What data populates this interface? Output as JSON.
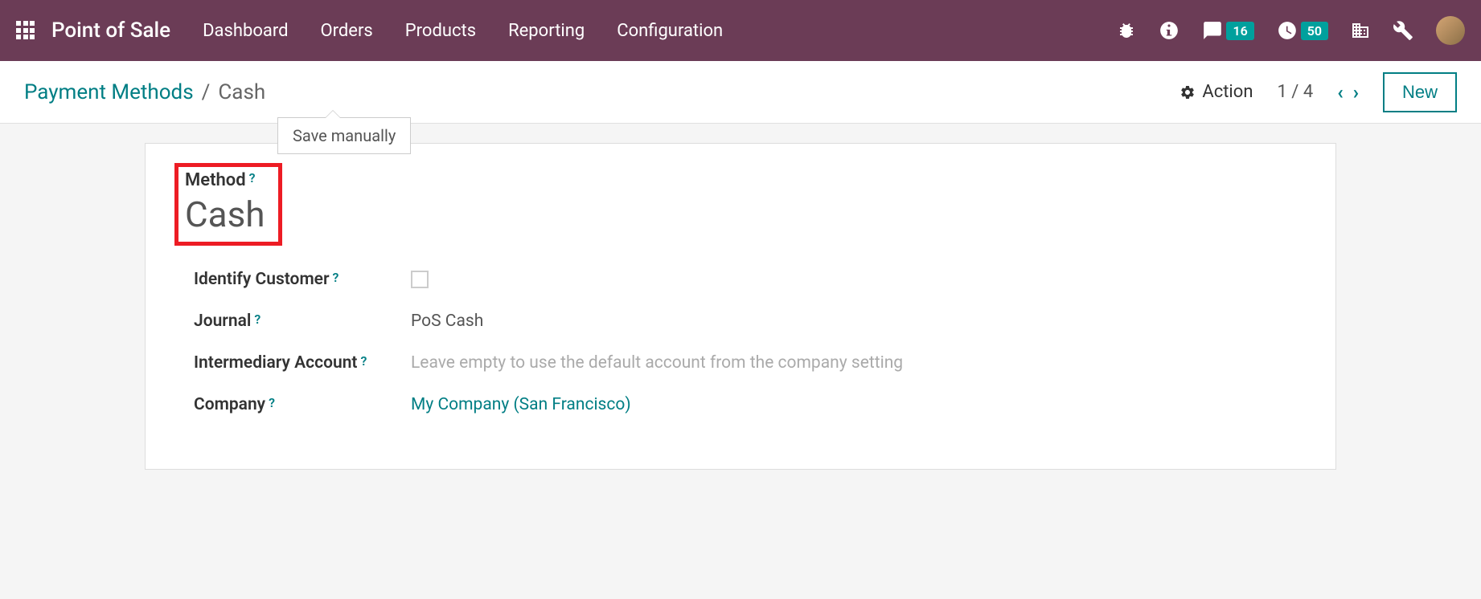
{
  "app": {
    "title": "Point of Sale"
  },
  "nav": {
    "dashboard": "Dashboard",
    "orders": "Orders",
    "products": "Products",
    "reporting": "Reporting",
    "configuration": "Configuration"
  },
  "badges": {
    "messages": "16",
    "activities": "50"
  },
  "breadcrumb": {
    "parent": "Payment Methods",
    "separator": "/",
    "current": "Cash"
  },
  "tooltip": {
    "save": "Save manually"
  },
  "actions": {
    "action_label": "Action",
    "pager": "1 / 4",
    "new_label": "New"
  },
  "form": {
    "method_label": "Method",
    "method_value": "Cash",
    "identify_customer_label": "Identify Customer",
    "journal_label": "Journal",
    "journal_value": "PoS Cash",
    "intermediary_label": "Intermediary Account",
    "intermediary_placeholder": "Leave empty to use the default account from the company setting",
    "company_label": "Company",
    "company_value": "My Company (San Francisco)"
  }
}
